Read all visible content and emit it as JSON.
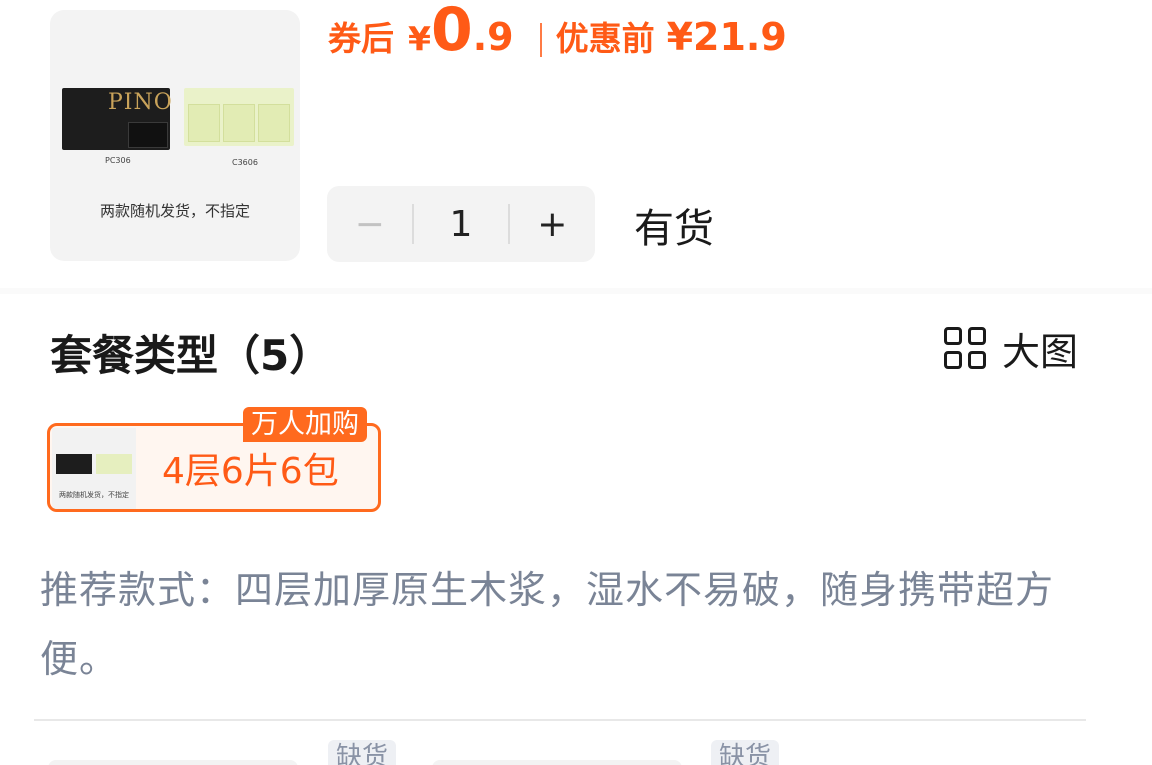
{
  "product": {
    "thumbnail": {
      "brand_text": "PINO",
      "model_left": "PC306",
      "model_right": "C3606",
      "note": "两款随机发货，不指定"
    },
    "price": {
      "coupon_label": "券后",
      "currency": "¥",
      "integer": "0",
      "decimal": ".9",
      "original_label": "优惠前",
      "original_value": "¥21.9"
    },
    "quantity": {
      "minus": "−",
      "value": "1",
      "plus": "+"
    },
    "stock_status": "有货"
  },
  "package_section": {
    "title": "套餐类型（5）",
    "view_icon": "grid-icon",
    "view_label": "大图",
    "options": [
      {
        "label": "4层6片6包",
        "tag": "万人加购",
        "thumb_note": "两款随机发货，不指定"
      }
    ],
    "description": "推荐款式：四层加厚原生木浆，湿水不易破，随身携带超方便。"
  },
  "next_row": {
    "tags": [
      "缺货",
      "缺货"
    ]
  },
  "colors": {
    "accent": "#ff5a16",
    "description_text": "#7a8496"
  }
}
